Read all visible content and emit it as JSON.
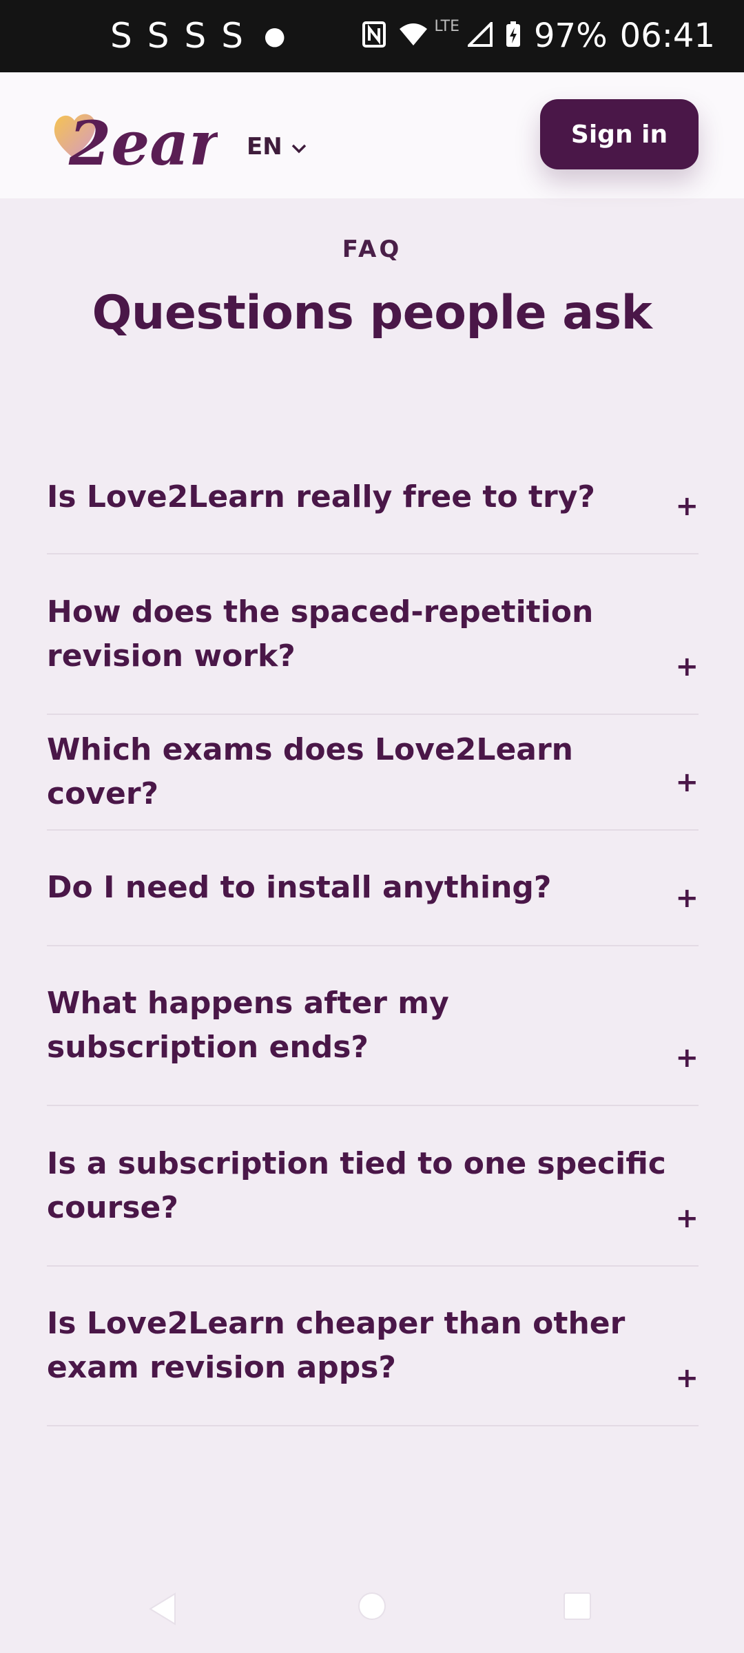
{
  "status_bar": {
    "notification_icons": [
      "S",
      "S",
      "S",
      "S"
    ],
    "battery": "97%",
    "time": "06:41",
    "network": "LTE",
    "icons": [
      "nfc-icon",
      "wifi-icon",
      "signal-icon",
      "battery-charging-icon"
    ]
  },
  "header": {
    "logo_text": "2earn",
    "language": "EN",
    "sign_in_label": "Sign in"
  },
  "faq": {
    "eyebrow": "FAQ",
    "title": "Questions people ask",
    "items": [
      {
        "question": "Is Love2Learn really free to try?",
        "expand": "+"
      },
      {
        "question": "How does the spaced-repetition revision work?",
        "expand": "+"
      },
      {
        "question": "Which exams does Love2Learn cover?",
        "expand": "+"
      },
      {
        "question": "Do I need to install anything?",
        "expand": "+"
      },
      {
        "question": "What happens after my subscription ends?",
        "expand": "+"
      },
      {
        "question": "Is a subscription tied to one specific course?",
        "expand": "+"
      },
      {
        "question": "Is Love2Learn cheaper than other exam revision apps?",
        "expand": "+"
      }
    ]
  },
  "colors": {
    "brand": "#4a1748",
    "background": "#f2ecf3",
    "header_bg": "#fbf9fc",
    "logo_gradient": [
      "#f5c451",
      "#c98ab8"
    ]
  },
  "nav_bar": {
    "icons": [
      "back-icon",
      "home-icon",
      "recents-icon"
    ]
  }
}
